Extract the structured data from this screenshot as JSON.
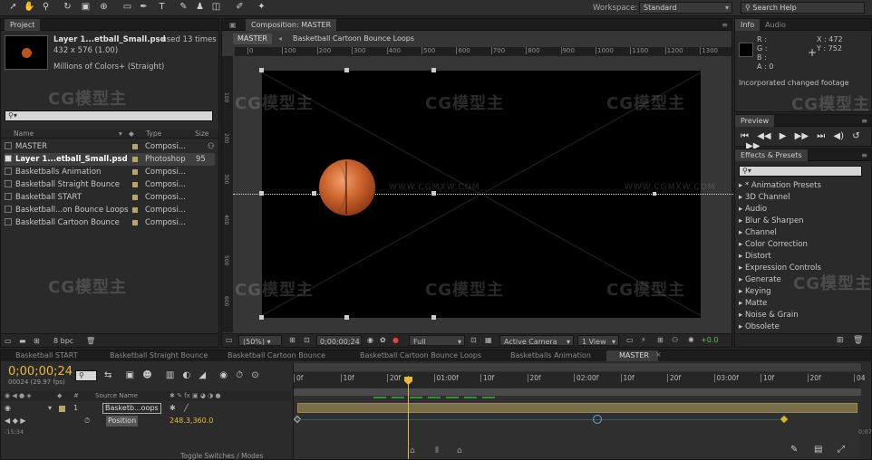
{
  "toolbar": {
    "workspace_label": "Workspace:",
    "workspace_value": "Standard",
    "search_placeholder": "Search Help"
  },
  "project": {
    "tab": "Project",
    "thumb_title": "Layer 1...etball_Small.psd",
    "used": ", used 13 times",
    "dims": "432 x 576 (1.00)",
    "colors": "Millions of Colors+ (Straight)",
    "columns": [
      "Name",
      "Type",
      "Size"
    ],
    "items": [
      {
        "name": "MASTER",
        "type": "Composi...",
        "size": ""
      },
      {
        "name": "Layer 1...etball_Small.psd",
        "type": "Photoshop",
        "size": "95"
      },
      {
        "name": "Basketballs Animation",
        "type": "Composi...",
        "size": ""
      },
      {
        "name": "Basketball Straight Bounce",
        "type": "Composi...",
        "size": ""
      },
      {
        "name": "Basketball START",
        "type": "Composi...",
        "size": ""
      },
      {
        "name": "Basketball...on Bounce Loops",
        "type": "Composi...",
        "size": ""
      },
      {
        "name": "Basketball Cartoon Bounce",
        "type": "Composi...",
        "size": ""
      }
    ],
    "bpc": "8 bpc"
  },
  "composition": {
    "tab": "Composition: MASTER",
    "breadcrumb_master": "MASTER",
    "breadcrumb_child": "Basketball Cartoon Bounce Loops",
    "ruler": [
      "0",
      "100",
      "200",
      "300",
      "400",
      "500",
      "600",
      "700",
      "800",
      "900",
      "1000",
      "1100",
      "1200",
      "1300"
    ],
    "vruler": [
      "100",
      "200",
      "300",
      "400",
      "500",
      "600"
    ],
    "zoom": "(50%)",
    "timecode": "0;00;00;24",
    "resolution": "Full",
    "camera": "Active Camera",
    "views": "1 View",
    "exposure": "+0.0"
  },
  "info": {
    "tab_info": "Info",
    "tab_audio": "Audio",
    "r": "R :",
    "g": "G :",
    "b": "B :",
    "a": "A : 0",
    "x": "X : 472",
    "y": "Y : 752",
    "message": "Incorporated changed footage"
  },
  "preview": {
    "tab": "Preview"
  },
  "effects": {
    "tab": "Effects & Presets",
    "items": [
      "* Animation Presets",
      "3D Channel",
      "Audio",
      "Blur & Sharpen",
      "Channel",
      "Color Correction",
      "Distort",
      "Expression Controls",
      "Generate",
      "Keying",
      "Matte",
      "Noise & Grain",
      "Obsolete"
    ]
  },
  "timeline": {
    "tabs": [
      "Basketball START",
      "Basketball Straight Bounce",
      "Basketball Cartoon Bounce",
      "Basketball Cartoon Bounce Loops",
      "Basketballs Animation",
      "MASTER"
    ],
    "active_tab": "MASTER",
    "timecode": "0;00;00;24",
    "fps": "00024 (29.97 fps)",
    "ruler": [
      "0f",
      "10f",
      "20f",
      "01:00f",
      "10f",
      "20f",
      "02:00f",
      "10f",
      "20f",
      "03:00f",
      "10f",
      "20f",
      "04"
    ],
    "source_name_header": "Source Name",
    "layer_index": "1",
    "layer_name": "Basketb...oops",
    "property": "Position",
    "property_value": "248.3,360.0",
    "toggle": "Toggle Switches / Modes",
    "left_time": "-15;34",
    "right_time": "0;07"
  },
  "watermark": {
    "logo": "CG模型主",
    "url": "WWW.CGMXW.COM"
  },
  "colors": {
    "accent": "#e7b93a",
    "keyframe": "#6fb34d",
    "comp_bg": "#000000"
  }
}
